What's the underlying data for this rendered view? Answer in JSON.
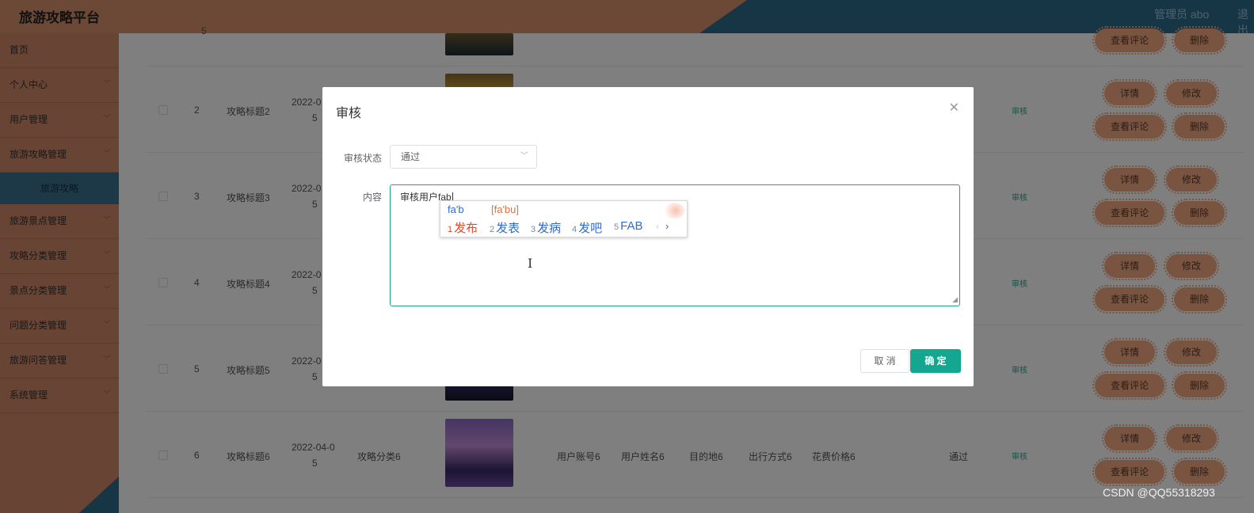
{
  "header": {
    "title": "旅游攻略平台",
    "admin": "管理员 abo",
    "logout": "退出"
  },
  "sidebar": {
    "items": [
      {
        "label": "首页",
        "has_arrow": false
      },
      {
        "label": "个人中心",
        "has_arrow": true
      },
      {
        "label": "用户管理",
        "has_arrow": true
      },
      {
        "label": "旅游攻略管理",
        "has_arrow": true
      },
      {
        "label": "旅游攻略",
        "sub": true
      },
      {
        "label": "旅游景点管理",
        "has_arrow": true
      },
      {
        "label": "攻略分类管理",
        "has_arrow": true
      },
      {
        "label": "景点分类管理",
        "has_arrow": true
      },
      {
        "label": "问题分类管理",
        "has_arrow": true
      },
      {
        "label": "旅游问答管理",
        "has_arrow": true
      },
      {
        "label": "系统管理",
        "has_arrow": true
      }
    ]
  },
  "table": {
    "row0": {
      "index": "5",
      "review_comments": "查看评论",
      "delete": "删除"
    },
    "rows": [
      {
        "index": "2",
        "title": "攻略标题2",
        "date_top": "2022-0",
        "date_bottom": "5",
        "audit": "审核"
      },
      {
        "index": "3",
        "title": "攻略标题3",
        "date_top": "2022-0",
        "date_bottom": "5",
        "audit": "审核"
      },
      {
        "index": "4",
        "title": "攻略标题4",
        "date_top": "2022-0",
        "date_bottom": "5",
        "audit": "审核"
      },
      {
        "index": "5",
        "title": "攻略标题5",
        "date_top": "2022-0",
        "date_bottom": "5",
        "audit": "审核"
      },
      {
        "index": "6",
        "title": "攻略标题6",
        "date_top": "2022-04-0",
        "date_bottom": "5",
        "category": "攻略分类6",
        "account": "用户账号6",
        "name": "用户姓名6",
        "destination": "目的地6",
        "travel_mode": "出行方式6",
        "cost": "花费价格6",
        "status": "通过",
        "audit": "审核"
      }
    ],
    "actions": {
      "detail": "详情",
      "edit": "修改",
      "review_comments": "查看评论",
      "delete": "删除"
    }
  },
  "modal": {
    "title": "审核",
    "status_label": "审核状态",
    "status_value": "通过",
    "content_label": "内容",
    "content_value": "审核用户fab",
    "cancel": "取 消",
    "confirm": "确 定"
  },
  "ime": {
    "composition": "fa'b",
    "pinyin": "[fa'bu]",
    "candidates": [
      {
        "num": "1",
        "text": "发布"
      },
      {
        "num": "2",
        "text": "发表"
      },
      {
        "num": "3",
        "text": "发病"
      },
      {
        "num": "4",
        "text": "发吧"
      },
      {
        "num": "5",
        "text": "FAB"
      }
    ],
    "prev": "‹",
    "next": "›"
  },
  "watermark": "CSDN @QQ55318293"
}
